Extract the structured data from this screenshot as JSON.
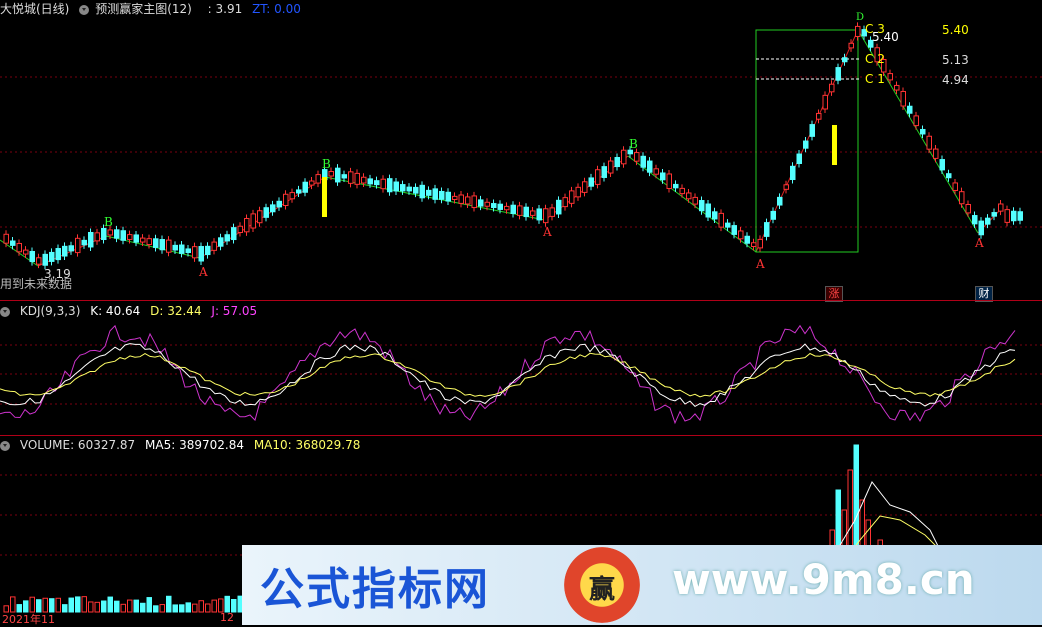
{
  "header": {
    "stock": "大悦城(日线)",
    "formula": "预测赢家主图(12)",
    "value": ": 3.91",
    "zt_label": "ZT: 0.00"
  },
  "main_chart": {
    "low_label": "3.19",
    "note": "用到未来数据",
    "peak_label": "5.40",
    "levels": [
      {
        "label": "C 3",
        "price": "5.40"
      },
      {
        "label": "C 2",
        "price": "5.13"
      },
      {
        "label": "C 1",
        "price": "4.94"
      }
    ],
    "wave_labels": [
      "A",
      "B",
      "A",
      "B",
      "A",
      "B",
      "A",
      "A",
      "D"
    ],
    "badge_zhang": "涨",
    "badge_cai": "财",
    "colors": {
      "up": "#ff3333",
      "down": "#54ffff",
      "signal": "#ffff00",
      "green": "#33dd33"
    }
  },
  "kdj": {
    "title": "KDJ(9,3,3)",
    "k": "K: 40.64",
    "d": "D: 32.44",
    "j": "J: 57.05"
  },
  "volume": {
    "title": "VOLUME: 60327.87",
    "ma5": "MA5: 389702.84",
    "ma10": "MA10: 368029.78"
  },
  "x_axis": {
    "label1": "2021年11",
    "label2": "12"
  },
  "watermark": {
    "text_cn": "公式指标网",
    "logo_text": "赢",
    "url": "www.9m8.cn"
  }
}
